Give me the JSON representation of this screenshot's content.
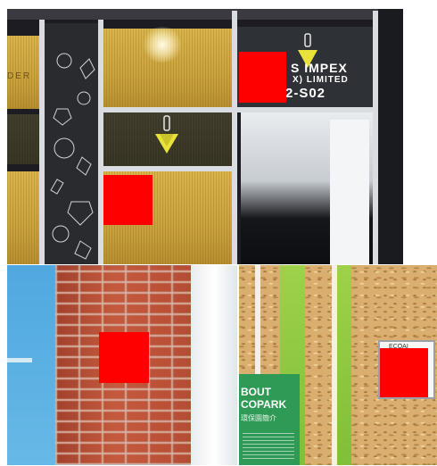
{
  "panels": {
    "booth": {
      "sign_line_1": "S IMPEX",
      "sign_line_2": "X) LIMITED",
      "sign_line_3": "2-S02",
      "edge_text": "DER"
    },
    "osb": {
      "board_title_line_1": "BOUT",
      "board_title_line_2": "COPARK",
      "board_subtitle": "環保園簡介",
      "card_text": "ECOAI"
    }
  },
  "colors": {
    "redaction": "#ff0000",
    "brand_yellow": "#e8e23a",
    "board_green": "#2f9a55"
  },
  "icons": [
    "gem-outline-icon",
    "diamond-logo-icon"
  ]
}
